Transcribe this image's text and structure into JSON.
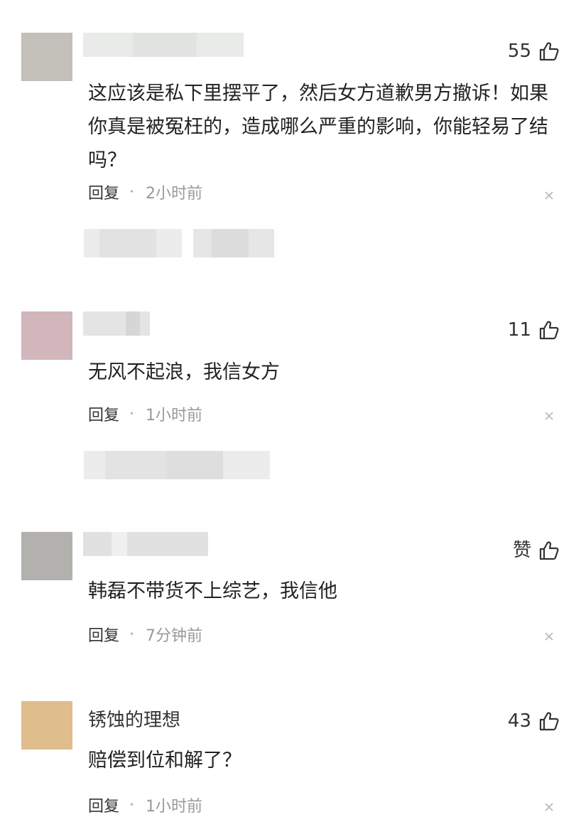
{
  "comments": [
    {
      "author": "",
      "author_blurred": true,
      "avatar_color": "#c3bfb9",
      "likes": "55",
      "text": "这应该是私下里摆平了，然后女方道歉男方撤诉！如果你真是被冤枉的，造成哪么严重的影响，你能轻易了结吗？",
      "reply_label": "回复",
      "time": "2小时前"
    },
    {
      "author": "",
      "author_blurred": true,
      "avatar_color": "#d1b6bc",
      "likes": "11",
      "text": "无风不起浪，我信女方",
      "reply_label": "回复",
      "time": "1小时前"
    },
    {
      "author": "",
      "author_blurred": true,
      "avatar_color": "#b3b1ae",
      "likes": "赞",
      "text": "韩磊不带货不上综艺，我信他",
      "reply_label": "回复",
      "time": "7分钟前"
    },
    {
      "author": "锈蚀的理想",
      "author_blurred": false,
      "avatar_color": "#e0bd8d",
      "likes": "43",
      "text": "赔偿到位和解了？",
      "reply_label": "回复",
      "time": "1小时前"
    }
  ],
  "meta_separator": "·",
  "icons": {
    "like": "thumbs-up-icon",
    "close": "close-icon"
  }
}
